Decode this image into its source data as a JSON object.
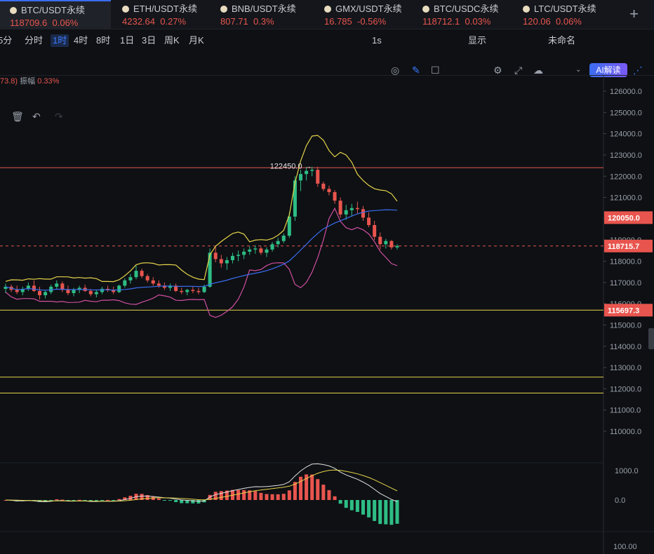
{
  "tabs": [
    {
      "symbol": "BTC/USDT永续",
      "price": "118709.6",
      "change": "0.06%",
      "active": true
    },
    {
      "symbol": "ETH/USDT永续",
      "price": "4232.64",
      "change": "0.27%"
    },
    {
      "symbol": "BNB/USDT永续",
      "price": "807.71",
      "change": "0.3%"
    },
    {
      "symbol": "GMX/USDT永续",
      "price": "16.785",
      "change": "-0.56%"
    },
    {
      "symbol": "BTC/USDC永续",
      "price": "118712.1",
      "change": "0.03%"
    },
    {
      "symbol": "LTC/USDT永续",
      "price": "120.06",
      "change": "0.06%"
    }
  ],
  "add_tab_label": "+",
  "timeframes": [
    "5分",
    "分时",
    "1时",
    "4时",
    "8时",
    "1日",
    "3日",
    "周K",
    "月K"
  ],
  "active_timeframe": "1时",
  "toolbar_right": {
    "refresh": "1s",
    "display": "显示",
    "layout_name": "未命名",
    "ai_button": "AI解读"
  },
  "oscillator": {
    "prefix": "73.8)",
    "amplitude_label": "振幅",
    "amplitude_value": "0.33%"
  },
  "colors": {
    "up": "#2ebd85",
    "down": "#e8554e",
    "accent": "#3a7bff",
    "bg": "#0e1014",
    "yellow": "#e6d44a",
    "pink": "#d04fa0",
    "blue": "#3a6df0"
  },
  "icons": {
    "camera": "camera-icon",
    "pen": "pen-icon",
    "edit": "edit-icon",
    "settings": "settings-icon",
    "fullscreen": "fullscreen-icon",
    "cloud": "cloud-icon",
    "share": "share-icon",
    "trash": "trash-icon",
    "undo": "undo-icon",
    "redo": "redo-icon"
  },
  "chart_data": {
    "type": "candlestick",
    "timeframe": "1时",
    "price_axis_ticks": [
      126000,
      125000,
      124000,
      123000,
      122000,
      121000,
      120000,
      119000,
      118000,
      117000,
      116000,
      115000,
      114000,
      113000,
      112000,
      111000,
      110000
    ],
    "price_axis_labels": [
      "126000.0",
      "125000.0",
      "124000.0",
      "123000.0",
      "122000.0",
      "121000.0",
      "120000.0",
      "119000.0",
      "118000.0",
      "117000.0",
      "116000.0",
      "115000.0",
      "114000.0",
      "113000.0",
      "112000.0",
      "111000.0",
      "110000.0"
    ],
    "ylim": [
      109500,
      126500
    ],
    "horizontal_lines": [
      {
        "price": 122400,
        "color": "#e8554e"
      },
      {
        "price": 115697.3,
        "color": "#e6d44a"
      },
      {
        "price": 112550,
        "color": "#e6d44a"
      },
      {
        "price": 111800,
        "color": "#e6d44a"
      }
    ],
    "current_price_line": 118715.7,
    "price_tags": [
      {
        "price": 120050.0,
        "label": "120050.0",
        "color": "#e8554e"
      },
      {
        "price": 118715.7,
        "label": "118715.7",
        "color": "#e8554e"
      },
      {
        "price": 115697.3,
        "label": "115697.3",
        "color": "#e8554e"
      }
    ],
    "high_marker": {
      "price": 122450.0,
      "label": "122450.0"
    },
    "candles": [
      [
        116700,
        116950,
        116500,
        116800
      ],
      [
        116800,
        116900,
        116550,
        116650
      ],
      [
        116650,
        116850,
        116450,
        116550
      ],
      [
        116550,
        116800,
        116400,
        116700
      ],
      [
        116700,
        117000,
        116600,
        116850
      ],
      [
        116850,
        117100,
        116550,
        116600
      ],
      [
        116600,
        116800,
        116200,
        116400
      ],
      [
        116400,
        116650,
        116250,
        116550
      ],
      [
        116550,
        116900,
        116450,
        116800
      ],
      [
        116800,
        117100,
        116700,
        116950
      ],
      [
        116950,
        117050,
        116550,
        116650
      ],
      [
        116650,
        116850,
        116400,
        116500
      ],
      [
        116500,
        116750,
        116350,
        116650
      ],
      [
        116650,
        116850,
        116500,
        116750
      ],
      [
        116750,
        116900,
        116550,
        116600
      ],
      [
        116600,
        116700,
        116350,
        116450
      ],
      [
        116450,
        116650,
        116300,
        116550
      ],
      [
        116550,
        116800,
        116450,
        116700
      ],
      [
        116700,
        116850,
        116550,
        116650
      ],
      [
        116650,
        116800,
        116450,
        116550
      ],
      [
        116550,
        116900,
        116500,
        116850
      ],
      [
        116850,
        117200,
        116750,
        117100
      ],
      [
        117100,
        117400,
        116950,
        117250
      ],
      [
        117250,
        117800,
        117150,
        117550
      ],
      [
        117550,
        117650,
        117200,
        117300
      ],
      [
        117300,
        117400,
        117000,
        117100
      ],
      [
        117100,
        117250,
        116850,
        116950
      ],
      [
        116950,
        117100,
        116750,
        116850
      ],
      [
        116850,
        117000,
        116650,
        116750
      ],
      [
        116750,
        116950,
        116600,
        116850
      ],
      [
        116850,
        116950,
        116550,
        116600
      ],
      [
        116600,
        116750,
        116450,
        116550
      ],
      [
        116550,
        116700,
        116400,
        116650
      ],
      [
        116650,
        116800,
        116500,
        116600
      ],
      [
        116600,
        116750,
        116450,
        116550
      ],
      [
        116550,
        116900,
        116500,
        116800
      ],
      [
        116800,
        118600,
        116750,
        118400
      ],
      [
        118400,
        118700,
        117950,
        118100
      ],
      [
        118100,
        118300,
        117700,
        117900
      ],
      [
        117900,
        118200,
        117600,
        118050
      ],
      [
        118050,
        118400,
        117900,
        118250
      ],
      [
        118250,
        118500,
        118000,
        118300
      ],
      [
        118300,
        118600,
        118100,
        118450
      ],
      [
        118450,
        118700,
        118300,
        118550
      ],
      [
        118550,
        118750,
        118350,
        118600
      ],
      [
        118600,
        118700,
        118300,
        118400
      ],
      [
        118400,
        118650,
        118200,
        118550
      ],
      [
        118550,
        118900,
        118450,
        118800
      ],
      [
        118800,
        119100,
        118650,
        118950
      ],
      [
        118950,
        119300,
        118850,
        119200
      ],
      [
        119200,
        120300,
        119100,
        120100
      ],
      [
        120100,
        122000,
        119900,
        121800
      ],
      [
        121800,
        122300,
        121300,
        122100
      ],
      [
        122100,
        122400,
        121800,
        122250
      ],
      [
        122250,
        122450,
        122000,
        122300
      ],
      [
        122300,
        122450,
        121500,
        121650
      ],
      [
        121650,
        121750,
        121300,
        121400
      ],
      [
        121400,
        121550,
        121100,
        121250
      ],
      [
        121250,
        121350,
        120700,
        120850
      ],
      [
        120850,
        121000,
        120050,
        120200
      ],
      [
        120200,
        120650,
        119950,
        120400
      ],
      [
        120400,
        120700,
        120100,
        120500
      ],
      [
        120500,
        120800,
        120250,
        120450
      ],
      [
        120450,
        120600,
        119900,
        120050
      ],
      [
        120050,
        120300,
        119600,
        119700
      ],
      [
        119700,
        119900,
        119000,
        119150
      ],
      [
        119150,
        119350,
        118550,
        118800
      ],
      [
        118800,
        119050,
        118600,
        118950
      ],
      [
        118950,
        119000,
        118550,
        118650
      ],
      [
        118650,
        118800,
        118550,
        118715.7
      ]
    ],
    "indicator_panel": {
      "ticks": [
        1000.0,
        0.0
      ],
      "tick_labels": [
        "1000.0",
        "0.0"
      ],
      "ylim": [
        -800,
        1200
      ]
    },
    "third_panel": {
      "tick_labels": [
        "100.00"
      ]
    }
  }
}
